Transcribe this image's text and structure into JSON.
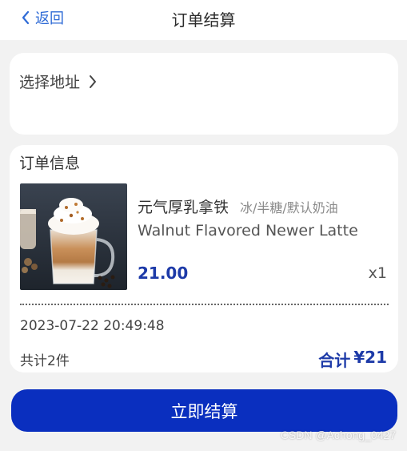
{
  "header": {
    "back_label": "返回",
    "title": "订单结算"
  },
  "address": {
    "label": "选择地址"
  },
  "order": {
    "section_title": "订单信息",
    "item": {
      "name": "元气厚乳拿铁",
      "spec": "冰/半糖/默认奶油",
      "english_name": "Walnut Flavored Newer Latte",
      "price": "21.00",
      "quantity": "x1",
      "image": "latte-photo"
    },
    "time": "2023-07-22 20:49:48",
    "count_text": "共计2件",
    "total_label": "合计",
    "total_value": "¥21"
  },
  "checkout_label": "立即结算",
  "watermark": "CSDN @Achong_0427",
  "colors": {
    "accent": "#0a2fbf",
    "price": "#1d3aa8",
    "back_link": "#2f6bd6",
    "background": "#f2f2f2"
  }
}
